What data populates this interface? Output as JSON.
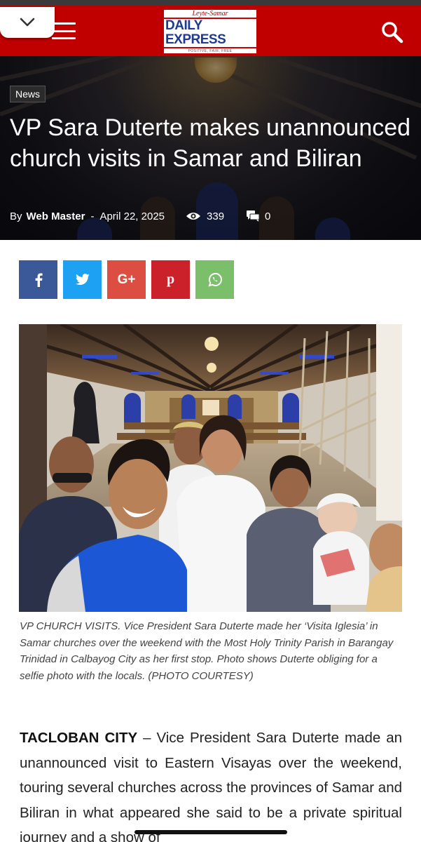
{
  "header": {
    "logo": {
      "top": "Leyte-Samar",
      "main": "DAILY EXPRESS",
      "tag": "POSITIVE, FAIR, FREE"
    },
    "brand_color": "#c00000",
    "icons": {
      "collapse": "chevron-down-icon",
      "menu": "hamburger-menu-icon",
      "search": "search-icon"
    }
  },
  "article": {
    "category": "News",
    "title": "VP Sara Duterte makes unannounced church visits in Samar and Biliran",
    "by_label": "By",
    "author": "Web Master",
    "separator": "-",
    "date": "April 22, 2025",
    "views": "339",
    "comments": "0"
  },
  "share": [
    {
      "network": "facebook",
      "glyph": "f",
      "color": "#3b5998"
    },
    {
      "network": "twitter",
      "glyph": "bird",
      "color": "#1da1f2"
    },
    {
      "network": "google-plus",
      "glyph": "G+",
      "color": "#dc4e41"
    },
    {
      "network": "pinterest",
      "glyph": "p",
      "color": "#ca212a"
    },
    {
      "network": "whatsapp",
      "glyph": "whatsapp",
      "color": "#7bbf6a"
    }
  ],
  "photo": {
    "caption": "VP CHURCH VISITS. Vice President Sara Duterte made her ‘Visita Iglesia’ in Samar churches over the weekend with the Most Holy Trinity Parish in Barangay Trinidad in Calbayog City as her first stop. Photo shows Duterte obliging for a selfie photo with the locals. (PHOTO COURTESY)"
  },
  "body": {
    "dateline": "TACLOBAN CITY",
    "dash": " – ",
    "text": "Vice President Sara Duterte made an unannounced visit to Eastern Visayas over the weekend, touring several churches across the provinces of Samar and Biliran in what appeared she said to be a private spiritual journey and a show of"
  }
}
